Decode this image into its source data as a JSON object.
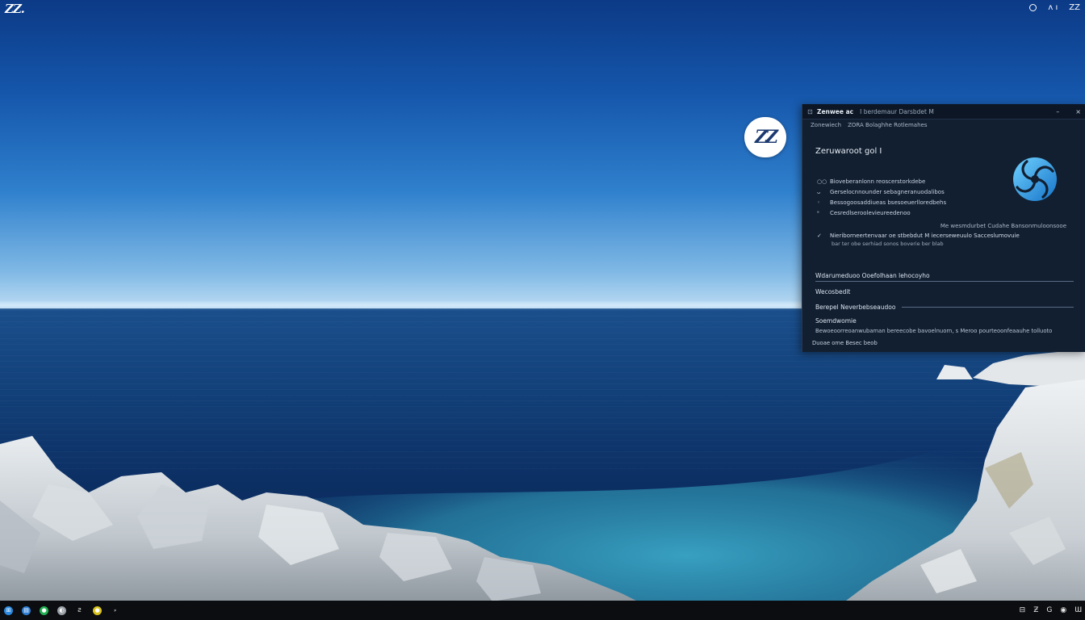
{
  "desktop": {
    "logo_text": "ZZ.",
    "top_tray": [
      "○",
      "ʌ ı",
      "ZZ"
    ],
    "icon": {
      "label": "ZZ"
    }
  },
  "window": {
    "app_glyph": "⊡",
    "title": "Zenwee ac",
    "subtitle": "I berdemaur Darsbdet M",
    "controls": [
      "–",
      "×"
    ],
    "path": [
      "Zonewiech",
      "ZORA Bolaghhe Rotlemahes"
    ],
    "heading": "Zeruwaroot gol I",
    "list": [
      {
        "bullet": "○○",
        "text": "Bioveberanlonn reoscerstorkdebe"
      },
      {
        "bullet": "ᴗ",
        "text": "Gerselocnnounder sebagneranuodalibos"
      },
      {
        "bullet": "◦",
        "text": "Bessogoosaddiueas bsesoeuerlloredbehs"
      },
      {
        "bullet": "ᵃ",
        "text": "Cesredlseroolevieureedenoo"
      }
    ],
    "note_right": "Me wesmdurbet Cudahe Bansonmuloonsooe",
    "info": {
      "bullet": "✓",
      "text": "Nieriborneertenvaar oe stbebdut M iecerseweuulo Sacceslumovuie",
      "sub": "bar ter obe serhiad sonos boverie ber blab"
    },
    "sections": {
      "s1": "Wdarumeduoo Ooefolhaan lehocoyho",
      "s2": "Wecosbedit",
      "s3": "Berepel Neverbebseaudoo",
      "s4": "Soemdwomie",
      "s4_desc": "Bewoeoorreoanwubaman bereecobe bavoelnuorn, s Meroo pourteoonfeaauhe tolluoto"
    },
    "footer_link": "Duoae ome Besec beob"
  },
  "taskbar": {
    "left_icons": [
      {
        "name": "start-icon",
        "glyph": "⊞",
        "color": "#2a8ae0"
      },
      {
        "name": "files-icon",
        "glyph": "▤",
        "color": "#2f7ed4"
      },
      {
        "name": "chat-icon",
        "glyph": "●",
        "color": "#22b054"
      },
      {
        "name": "globe-icon",
        "glyph": "◐",
        "color": "#9aa0a6"
      },
      {
        "name": "text-app-icon",
        "glyph": "Ƨ",
        "color": "#0b0d10"
      },
      {
        "name": "star-icon",
        "glyph": "●",
        "color": "#d8c21a"
      },
      {
        "name": "misc-icon",
        "glyph": "⸗",
        "color": "#0b0d10"
      }
    ],
    "right_items": [
      "⊟",
      "Ƶ",
      "G",
      "◉",
      "Ɯ"
    ]
  }
}
